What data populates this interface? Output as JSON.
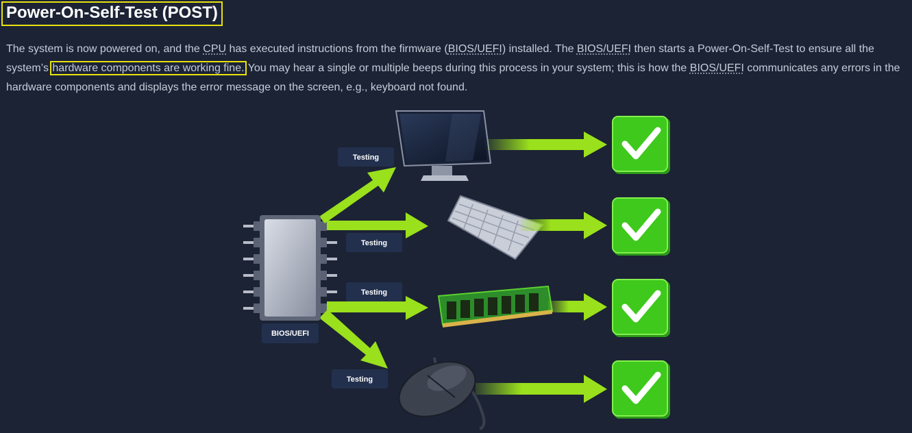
{
  "title": "Power-On-Self-Test (POST)",
  "paragraph": {
    "p1": "The system is now powered on, and the ",
    "cpu": "CPU",
    "p2": " has executed instructions from the firmware (",
    "bios_uefi": "BIOS/UEFI",
    "p3": ") installed. The ",
    "p4": " then starts a Power-On-Self-Test to ensure all the system’s ",
    "highlight": "hardware components are working fine.",
    "p5": " You may hear a single or multiple beeps during this process in your system; this is how the ",
    "p6": " communicates any errors in the hardware components and displays the error message on the screen, e.g., keyboard not found."
  },
  "diagram": {
    "chip_label": "BIOS/UEFI",
    "testing_label": "Testing",
    "components": [
      "monitor",
      "keyboard",
      "ram",
      "mouse"
    ],
    "status_icons": [
      "check-icon",
      "check-icon",
      "check-icon",
      "check-icon"
    ],
    "colors": {
      "arrow": "#9ae01c",
      "check_bg": "#3ec91c",
      "label_bg": "#22304d",
      "highlight": "#e8e20f"
    }
  }
}
